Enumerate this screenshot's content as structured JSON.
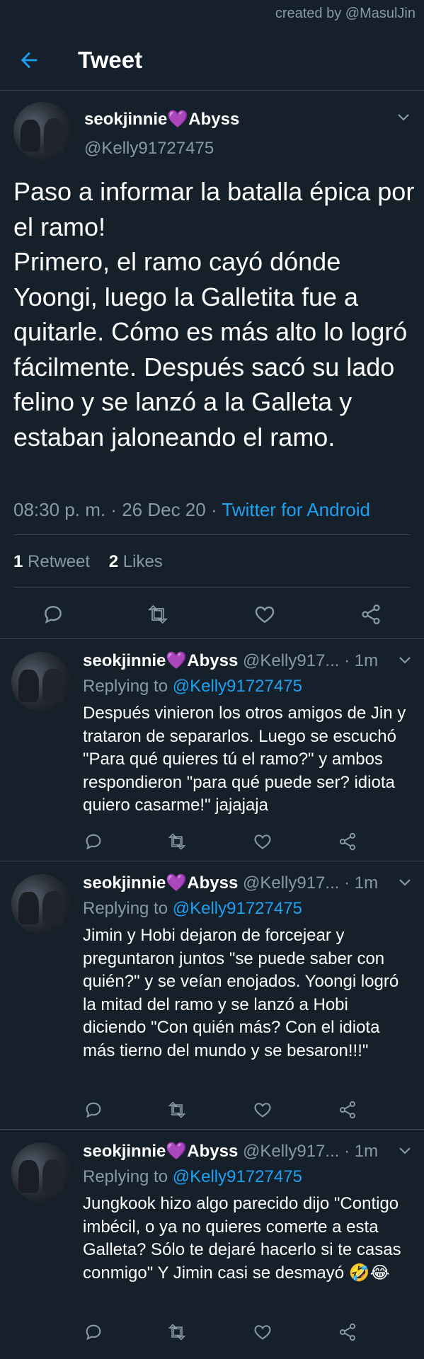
{
  "watermark": "created by @MasulJin",
  "header": {
    "title": "Tweet"
  },
  "main_tweet": {
    "display_name": "seokjinnie💜Abyss",
    "handle": "@Kelly91727475",
    "text": "Paso a informar la batalla épica por el ramo!\nPrimero, el ramo cayó dónde Yoongi, luego la Galletita fue a quitarle. Cómo es más alto lo logró fácilmente. Después sacó su lado felino y se lanzó a la Galleta y estaban jaloneando el ramo.",
    "time": "08:30 p. m.",
    "date": "26 Dec 20",
    "source": "Twitter for Android",
    "retweets_count": "1",
    "retweets_label": "Retweet",
    "likes_count": "2",
    "likes_label": "Likes"
  },
  "replies": [
    {
      "display_name": "seokjinnie💜Abyss",
      "handle": "@Kelly917...",
      "time": "1m",
      "replying_label": "Replying to",
      "replying_to": "@Kelly91727475",
      "text": "Después vinieron los otros amigos de Jin y trataron de separarlos. Luego se escuchó \"Para qué quieres tú el ramo?\" y ambos respondieron \"para qué puede ser? idiota quiero casarme!\" jajajaja"
    },
    {
      "display_name": "seokjinnie💜Abyss",
      "handle": "@Kelly917...",
      "time": "1m",
      "replying_label": "Replying to",
      "replying_to": "@Kelly91727475",
      "text": "Jimin y Hobi dejaron de forcejear y preguntaron juntos \"se puede saber con quién?\" y se veían enojados. Yoongi logró la mitad del ramo y se lanzó a Hobi diciendo \"Con quién más? Con el idiota más tierno del mundo y se besaron!!!\""
    },
    {
      "display_name": "seokjinnie💜Abyss",
      "handle": "@Kelly917...",
      "time": "1m",
      "replying_label": "Replying to",
      "replying_to": "@Kelly91727475",
      "text": "Jungkook hizo algo parecido dijo \"Contigo imbécil, o ya no quieres comerte a esta Galleta? Sólo te dejaré hacerlo si te casas conmigo\" Y Jimin casi se desmayó 🤣😂"
    }
  ],
  "icons": {
    "back": "arrow-left-icon",
    "reply": "comment-icon",
    "retweet": "retweet-icon",
    "like": "heart-icon",
    "share": "share-icon",
    "more": "chevron-down-icon"
  },
  "colors": {
    "background": "#15202b",
    "accent": "#1da1f2",
    "muted": "#8899a6",
    "divider": "#38444d"
  }
}
